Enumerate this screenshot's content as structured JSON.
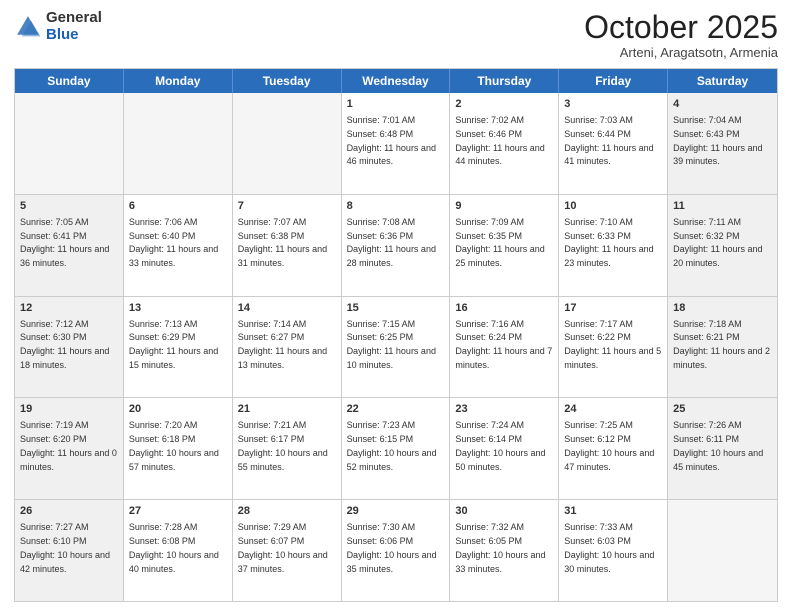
{
  "header": {
    "logo_general": "General",
    "logo_blue": "Blue",
    "month_title": "October 2025",
    "subtitle": "Arteni, Aragatsotn, Armenia"
  },
  "days_of_week": [
    "Sunday",
    "Monday",
    "Tuesday",
    "Wednesday",
    "Thursday",
    "Friday",
    "Saturday"
  ],
  "rows": [
    [
      {
        "day": "",
        "info": "",
        "empty": true
      },
      {
        "day": "",
        "info": "",
        "empty": true
      },
      {
        "day": "",
        "info": "",
        "empty": true
      },
      {
        "day": "1",
        "info": "Sunrise: 7:01 AM\nSunset: 6:48 PM\nDaylight: 11 hours and 46 minutes.",
        "empty": false
      },
      {
        "day": "2",
        "info": "Sunrise: 7:02 AM\nSunset: 6:46 PM\nDaylight: 11 hours and 44 minutes.",
        "empty": false
      },
      {
        "day": "3",
        "info": "Sunrise: 7:03 AM\nSunset: 6:44 PM\nDaylight: 11 hours and 41 minutes.",
        "empty": false
      },
      {
        "day": "4",
        "info": "Sunrise: 7:04 AM\nSunset: 6:43 PM\nDaylight: 11 hours and 39 minutes.",
        "empty": false,
        "shaded": true
      }
    ],
    [
      {
        "day": "5",
        "info": "Sunrise: 7:05 AM\nSunset: 6:41 PM\nDaylight: 11 hours and 36 minutes.",
        "empty": false,
        "shaded": true
      },
      {
        "day": "6",
        "info": "Sunrise: 7:06 AM\nSunset: 6:40 PM\nDaylight: 11 hours and 33 minutes.",
        "empty": false
      },
      {
        "day": "7",
        "info": "Sunrise: 7:07 AM\nSunset: 6:38 PM\nDaylight: 11 hours and 31 minutes.",
        "empty": false
      },
      {
        "day": "8",
        "info": "Sunrise: 7:08 AM\nSunset: 6:36 PM\nDaylight: 11 hours and 28 minutes.",
        "empty": false
      },
      {
        "day": "9",
        "info": "Sunrise: 7:09 AM\nSunset: 6:35 PM\nDaylight: 11 hours and 25 minutes.",
        "empty": false
      },
      {
        "day": "10",
        "info": "Sunrise: 7:10 AM\nSunset: 6:33 PM\nDaylight: 11 hours and 23 minutes.",
        "empty": false
      },
      {
        "day": "11",
        "info": "Sunrise: 7:11 AM\nSunset: 6:32 PM\nDaylight: 11 hours and 20 minutes.",
        "empty": false,
        "shaded": true
      }
    ],
    [
      {
        "day": "12",
        "info": "Sunrise: 7:12 AM\nSunset: 6:30 PM\nDaylight: 11 hours and 18 minutes.",
        "empty": false,
        "shaded": true
      },
      {
        "day": "13",
        "info": "Sunrise: 7:13 AM\nSunset: 6:29 PM\nDaylight: 11 hours and 15 minutes.",
        "empty": false
      },
      {
        "day": "14",
        "info": "Sunrise: 7:14 AM\nSunset: 6:27 PM\nDaylight: 11 hours and 13 minutes.",
        "empty": false
      },
      {
        "day": "15",
        "info": "Sunrise: 7:15 AM\nSunset: 6:25 PM\nDaylight: 11 hours and 10 minutes.",
        "empty": false
      },
      {
        "day": "16",
        "info": "Sunrise: 7:16 AM\nSunset: 6:24 PM\nDaylight: 11 hours and 7 minutes.",
        "empty": false
      },
      {
        "day": "17",
        "info": "Sunrise: 7:17 AM\nSunset: 6:22 PM\nDaylight: 11 hours and 5 minutes.",
        "empty": false
      },
      {
        "day": "18",
        "info": "Sunrise: 7:18 AM\nSunset: 6:21 PM\nDaylight: 11 hours and 2 minutes.",
        "empty": false,
        "shaded": true
      }
    ],
    [
      {
        "day": "19",
        "info": "Sunrise: 7:19 AM\nSunset: 6:20 PM\nDaylight: 11 hours and 0 minutes.",
        "empty": false,
        "shaded": true
      },
      {
        "day": "20",
        "info": "Sunrise: 7:20 AM\nSunset: 6:18 PM\nDaylight: 10 hours and 57 minutes.",
        "empty": false
      },
      {
        "day": "21",
        "info": "Sunrise: 7:21 AM\nSunset: 6:17 PM\nDaylight: 10 hours and 55 minutes.",
        "empty": false
      },
      {
        "day": "22",
        "info": "Sunrise: 7:23 AM\nSunset: 6:15 PM\nDaylight: 10 hours and 52 minutes.",
        "empty": false
      },
      {
        "day": "23",
        "info": "Sunrise: 7:24 AM\nSunset: 6:14 PM\nDaylight: 10 hours and 50 minutes.",
        "empty": false
      },
      {
        "day": "24",
        "info": "Sunrise: 7:25 AM\nSunset: 6:12 PM\nDaylight: 10 hours and 47 minutes.",
        "empty": false
      },
      {
        "day": "25",
        "info": "Sunrise: 7:26 AM\nSunset: 6:11 PM\nDaylight: 10 hours and 45 minutes.",
        "empty": false,
        "shaded": true
      }
    ],
    [
      {
        "day": "26",
        "info": "Sunrise: 7:27 AM\nSunset: 6:10 PM\nDaylight: 10 hours and 42 minutes.",
        "empty": false,
        "shaded": true
      },
      {
        "day": "27",
        "info": "Sunrise: 7:28 AM\nSunset: 6:08 PM\nDaylight: 10 hours and 40 minutes.",
        "empty": false
      },
      {
        "day": "28",
        "info": "Sunrise: 7:29 AM\nSunset: 6:07 PM\nDaylight: 10 hours and 37 minutes.",
        "empty": false
      },
      {
        "day": "29",
        "info": "Sunrise: 7:30 AM\nSunset: 6:06 PM\nDaylight: 10 hours and 35 minutes.",
        "empty": false
      },
      {
        "day": "30",
        "info": "Sunrise: 7:32 AM\nSunset: 6:05 PM\nDaylight: 10 hours and 33 minutes.",
        "empty": false
      },
      {
        "day": "31",
        "info": "Sunrise: 7:33 AM\nSunset: 6:03 PM\nDaylight: 10 hours and 30 minutes.",
        "empty": false
      },
      {
        "day": "",
        "info": "",
        "empty": true
      }
    ]
  ]
}
